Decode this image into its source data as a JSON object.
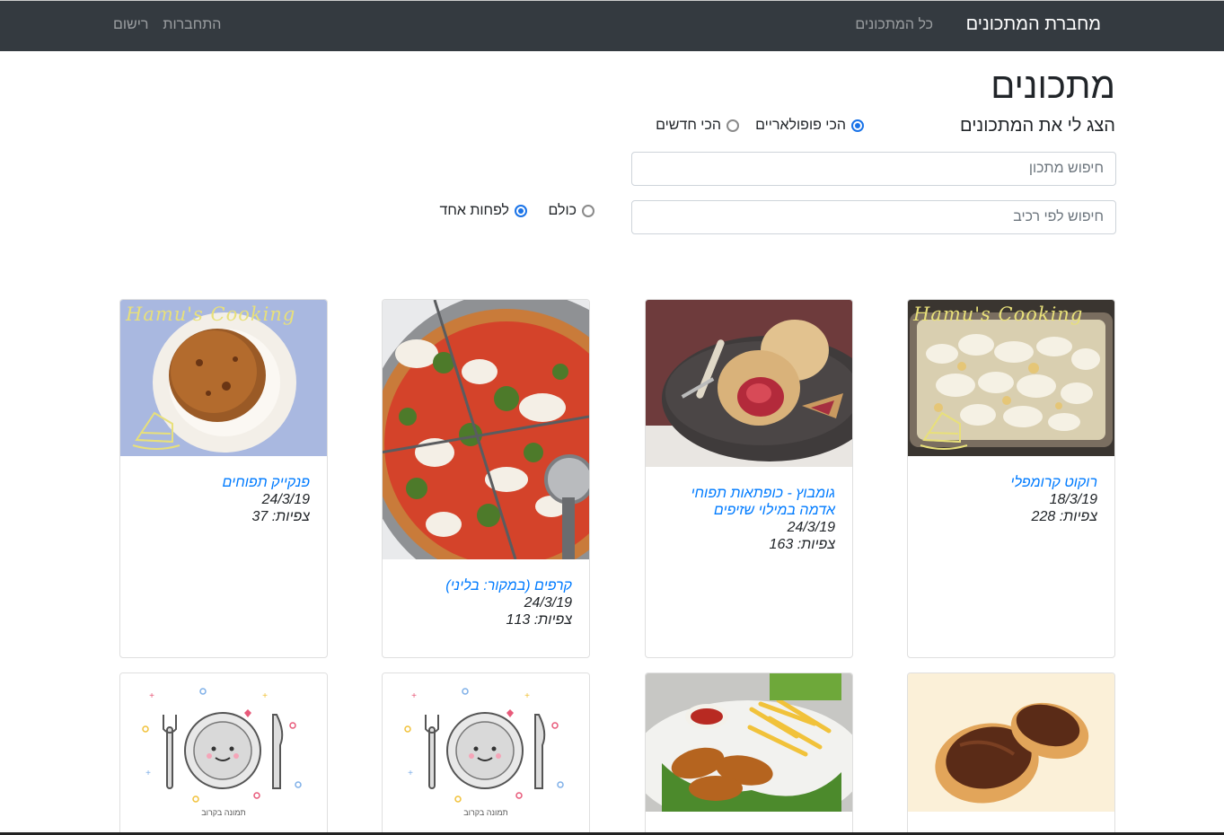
{
  "navbar": {
    "brand": "מחברת המתכונים",
    "all_recipes": "כל המתכונים",
    "register": "רישום",
    "login": "התחברות"
  },
  "page": {
    "title": "מתכונים",
    "sort_label": "הצג לי את המתכונים",
    "sort_options": {
      "popular": "הכי פופולאריים",
      "newest": "הכי חדשים",
      "selected": "popular"
    },
    "search_recipe_placeholder": "חיפוש מתכון",
    "search_ingredient_placeholder": "חיפוש לפי רכיב",
    "ingredient_match": {
      "all": "כולם",
      "any": "לפחות אחד",
      "selected": "any"
    }
  },
  "recipes": [
    {
      "title": "רוקוט קרומפלי",
      "date": "18/3/19",
      "views_label": "צפיות:",
      "views": "228",
      "image": "potato-casserole",
      "watermark": "Hamu's Cooking"
    },
    {
      "title": "גומבוץ - כופתאות תפוחי אדמה במילוי שזיפים",
      "date": "24/3/19",
      "views_label": "צפיות:",
      "views": "163",
      "image": "plum-dumplings"
    },
    {
      "title": "קרפים (במקור: בליני)",
      "date": "24/3/19",
      "views_label": "צפיות:",
      "views": "113",
      "image": "pizza"
    },
    {
      "title": "פנקייק תפוחים",
      "date": "24/3/19",
      "views_label": "צפיות:",
      "views": "37",
      "image": "apple-pancake",
      "watermark": "Hamu's Cooking"
    },
    {
      "image": "chocolate-toast"
    },
    {
      "image": "schnitzel-fries"
    },
    {
      "image": "placeholder-plate",
      "caption": "תמונה בקרוב"
    },
    {
      "image": "placeholder-plate",
      "caption": "תמונה בקרוב"
    }
  ],
  "colors": {
    "navbar_bg": "#343a40",
    "link": "#007bff",
    "radio_accent": "#1a73e8"
  }
}
